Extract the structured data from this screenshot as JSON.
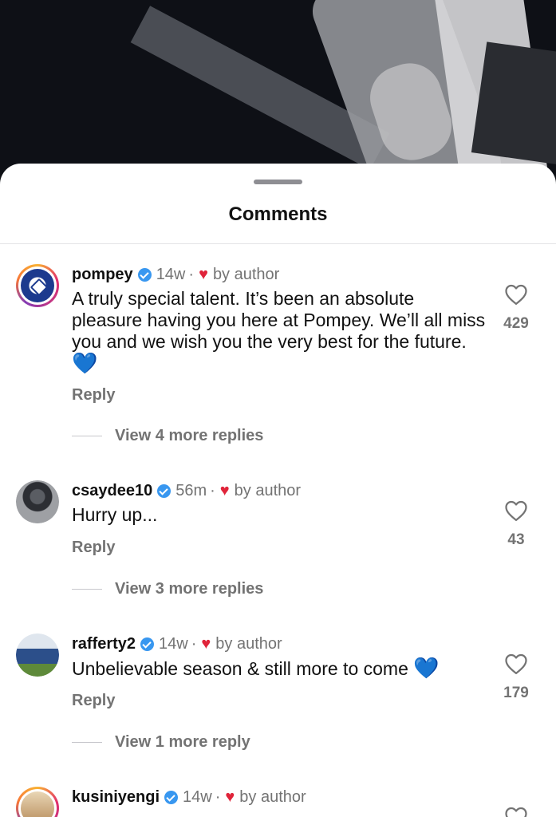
{
  "sheet": {
    "title": "Comments"
  },
  "comments": [
    {
      "username": "pompey",
      "time": "14w",
      "author_label": "by author",
      "text": "A truly special talent. It’s been an absolute pleasure having you here at Pompey. We’ll all miss you and we wish you the very best for the future.",
      "emoji": "💙",
      "likes": "429",
      "reply_label": "Reply",
      "more_replies": "View 4 more replies"
    },
    {
      "username": "csaydee10",
      "time": "56m",
      "author_label": "by author",
      "text": "Hurry up...",
      "likes": "43",
      "reply_label": "Reply",
      "more_replies": "View 3 more replies"
    },
    {
      "username": "rafferty2",
      "time": "14w",
      "author_label": "by author",
      "text": "Unbelievable season & still more to come",
      "emoji": "💙",
      "likes": "179",
      "reply_label": "Reply",
      "more_replies": "View 1 more reply"
    },
    {
      "username": "kusiniyengi",
      "time": "14w",
      "author_label": "by author"
    }
  ],
  "icons": {
    "verified": "verified-badge-icon",
    "author_like": "red-heart-icon",
    "like": "heart-outline-icon"
  },
  "colors": {
    "verified": "#3897f0",
    "author_heart": "#e0243a",
    "secondary_text": "#737373"
  }
}
